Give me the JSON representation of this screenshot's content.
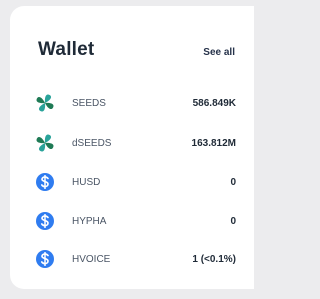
{
  "wallet": {
    "title": "Wallet",
    "see_all_label": "See all",
    "tokens": [
      {
        "name": "SEEDS",
        "amount": "586.849K",
        "icon": "seeds-logo-icon"
      },
      {
        "name": "dSEEDS",
        "amount": "163.812M",
        "icon": "seeds-logo-icon"
      },
      {
        "name": "HUSD",
        "amount": "0",
        "icon": "dollar-circle-icon"
      },
      {
        "name": "HYPHA",
        "amount": "0",
        "icon": "dollar-circle-icon"
      },
      {
        "name": "HVOICE",
        "amount": "1 (<0.1%)",
        "icon": "dollar-circle-icon"
      }
    ]
  },
  "colors": {
    "page_background": "#ececee",
    "card_background": "#ffffff",
    "dollar_icon_blue": "#2f7cf0",
    "seeds_green": "#1f7a55",
    "seeds_teal": "#2aa39a"
  }
}
